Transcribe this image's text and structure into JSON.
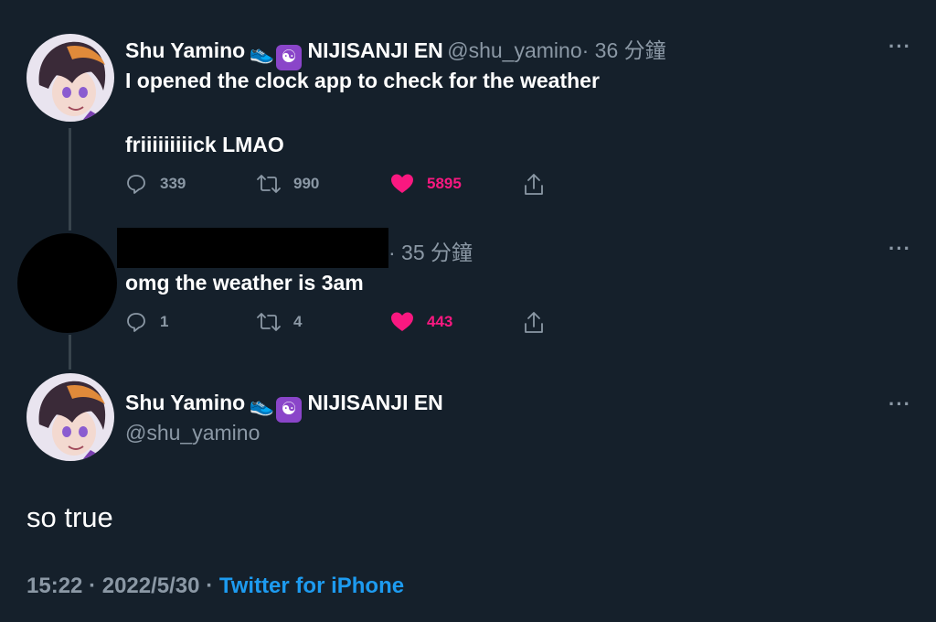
{
  "tweet1": {
    "name": "Shu Yamino",
    "affiliation": "NIJISANJI EN",
    "handle": "@shu_yamino",
    "time": "· 36 分鐘",
    "line1": "I opened the clock app to check for the weather",
    "line2": "friiiiiiiiick LMAO",
    "replies": "339",
    "retweets": "990",
    "likes": "5895"
  },
  "tweet2": {
    "time": "· 35 分鐘",
    "text": "omg the weather is 3am",
    "replies": "1",
    "retweets": "4",
    "likes": "443"
  },
  "main_tweet": {
    "name": "Shu Yamino",
    "affiliation": "NIJISANJI EN",
    "handle": "@shu_yamino",
    "text": "so true",
    "time": "15:22",
    "date": "2022/5/30",
    "source": "Twitter for iPhone"
  },
  "colors": {
    "background": "#15202b",
    "muted": "#8b98a5",
    "like": "#f91880",
    "link": "#1d9bf0",
    "thread_line": "#38444d"
  },
  "icons": {
    "reply": "speech-bubble",
    "retweet": "retweet-arrows",
    "like": "heart-filled",
    "share": "share-up-arrow",
    "more": "ellipsis"
  }
}
